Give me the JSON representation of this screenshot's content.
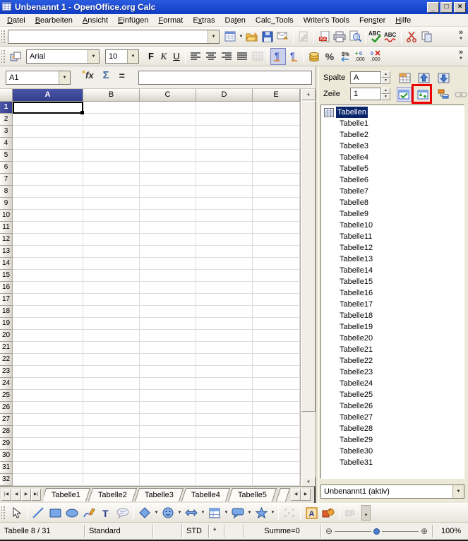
{
  "window": {
    "title": "Unbenannt 1 - OpenOffice.org Calc",
    "minimize": "_",
    "maximize": "□",
    "close": "×"
  },
  "menu": {
    "items": [
      {
        "pre": "",
        "accel": "D",
        "post": "atei"
      },
      {
        "pre": "",
        "accel": "B",
        "post": "earbeiten"
      },
      {
        "pre": "",
        "accel": "A",
        "post": "nsicht"
      },
      {
        "pre": "",
        "accel": "E",
        "post": "infügen"
      },
      {
        "pre": "",
        "accel": "F",
        "post": "ormat"
      },
      {
        "pre": "E",
        "accel": "x",
        "post": "tras"
      },
      {
        "pre": "Da",
        "accel": "t",
        "post": "en"
      },
      {
        "pre": "Calc_Tools",
        "accel": "",
        "post": ""
      },
      {
        "pre": "Writer's Tools",
        "accel": "",
        "post": ""
      },
      {
        "pre": "Fen",
        "accel": "s",
        "post": "ter"
      },
      {
        "pre": "",
        "accel": "H",
        "post": "ilfe"
      }
    ]
  },
  "standard_toolbar": {
    "url_box_value": "",
    "overflow": "»",
    "icons": [
      "new-document",
      "open",
      "save",
      "email",
      "edit-file",
      "export-pdf",
      "print",
      "page-preview",
      "spellcheck",
      "autospellcheck",
      "cut",
      "copy"
    ]
  },
  "formatting_toolbar": {
    "font_name": "Arial",
    "font_size": "10",
    "bold_label": "F",
    "italic_label": "K",
    "underline_label": "U",
    "percent_label": "%",
    "overflow": "»",
    "icons": [
      "styles",
      "align-left",
      "align-center",
      "align-right",
      "align-justify",
      "merge-cells",
      "ltr-direction",
      "rtl-direction",
      "currency",
      "percent",
      "standard-format",
      "add-decimal",
      "delete-decimal"
    ]
  },
  "formula_bar": {
    "cell_reference": "A1",
    "fx_label": "fx",
    "sum_label": "Σ",
    "equals_label": "=",
    "input_value": ""
  },
  "grid": {
    "column_headers": [
      "A",
      "B",
      "C",
      "D",
      "E"
    ],
    "first_row": 1,
    "last_row": 32,
    "selected_column": "A",
    "selected_row": 1,
    "selected_cell": "A1"
  },
  "sheet_tabs": {
    "tabs": [
      "Tabelle1",
      "Tabelle2",
      "Tabelle3",
      "Tabelle4",
      "Tabelle5"
    ]
  },
  "navigator": {
    "column_label": "Spalte",
    "column_value": "A",
    "row_label": "Zeile",
    "row_value": "1",
    "tree_root": "Tabellen",
    "tree_items": [
      "Tabelle1",
      "Tabelle2",
      "Tabelle3",
      "Tabelle4",
      "Tabelle5",
      "Tabelle6",
      "Tabelle7",
      "Tabelle8",
      "Tabelle9",
      "Tabelle10",
      "Tabelle11",
      "Tabelle12",
      "Tabelle13",
      "Tabelle14",
      "Tabelle15",
      "Tabelle16",
      "Tabelle17",
      "Tabelle18",
      "Tabelle19",
      "Tabelle20",
      "Tabelle21",
      "Tabelle22",
      "Tabelle23",
      "Tabelle24",
      "Tabelle25",
      "Tabelle26",
      "Tabelle27",
      "Tabelle28",
      "Tabelle29",
      "Tabelle30",
      "Tabelle31"
    ],
    "document_selector": "Unbenannt1 (aktiv)"
  },
  "status_bar": {
    "sheet_info": "Tabelle 8 / 31",
    "page_style": "Standard",
    "insert_mode": "STD",
    "modified_flag": "*",
    "selection_sum": "Summe=0",
    "zoom_level": "100%"
  },
  "colors": {
    "titlebar": "#1c4bd4",
    "selected_header": "#3c4394",
    "tree_selection": "#0a246a",
    "highlight_box": "#ee0000"
  }
}
